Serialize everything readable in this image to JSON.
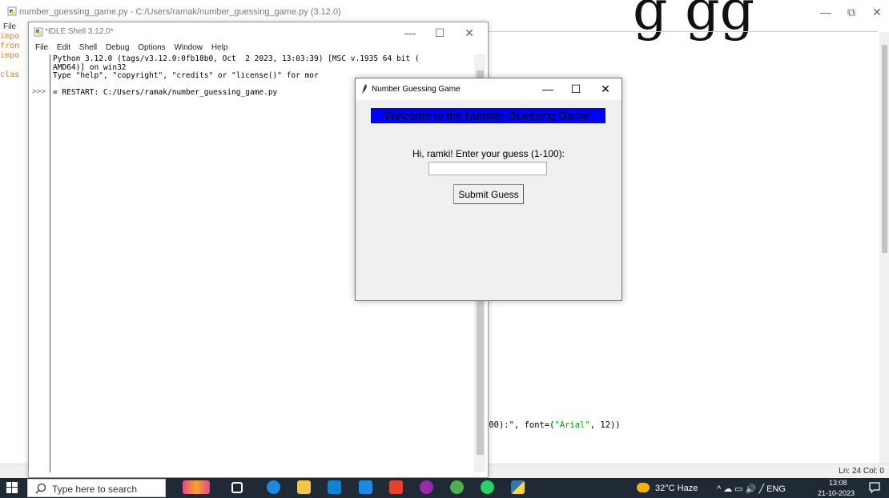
{
  "editor": {
    "title": "number_guessing_game.py - C:/Users/ramak/number_guessing_game.py (3.12.0)",
    "file_menu": "File",
    "code_lines_left": [
      "impo",
      "fron",
      "impo",
      "",
      "clas"
    ],
    "big_title": "g  gg",
    "code_fragment_text": "100):\", font=(",
    "code_fragment_string": "\"Arial\"",
    "code_fragment_end": ", 12))",
    "status": "Ln: 24  Col: 0",
    "minimize": "—",
    "restore": "⧉",
    "close": "✕"
  },
  "shell": {
    "title": "*IDLE Shell 3.12.0*",
    "menu": [
      "File",
      "Edit",
      "Shell",
      "Debug",
      "Options",
      "Window",
      "Help"
    ],
    "prompt": ">>>",
    "line1": "Python 3.12.0 (tags/v3.12.0:0fb18b0, Oct  2 2023, 13:03:39) [MSC v.1935 64 bit (",
    "line2": "AMD64)] on win32",
    "line3": "Type \"help\", \"copyright\", \"credits\" or \"license()\" for mor",
    "line4": "",
    "line5": "= RESTART: C:/Users/ramak/number_guessing_game.py",
    "minimize": "—",
    "maximize": "☐",
    "close": "✕"
  },
  "game": {
    "title": "Number Guessing Game",
    "welcome": "Welcome to the Number Guessing Game!",
    "prompt": "Hi, ramki! Enter your guess (1-100):",
    "guess_value": "",
    "submit_label": "Submit Guess",
    "minimize": "—",
    "maximize": "☐",
    "close": "✕"
  },
  "taskbar": {
    "search_placeholder": "Type here to search",
    "weather": "32°C  Haze",
    "tray": "^ ☁ ▭ 🔊 ╱ ENG",
    "time": "13:08",
    "date": "21-10-2023"
  },
  "colors": {
    "welcome_bg": "#0000ff",
    "taskbar_bg": "#1f2a36",
    "keyword_orange": "#ff7700",
    "string_green": "#00aa00"
  }
}
